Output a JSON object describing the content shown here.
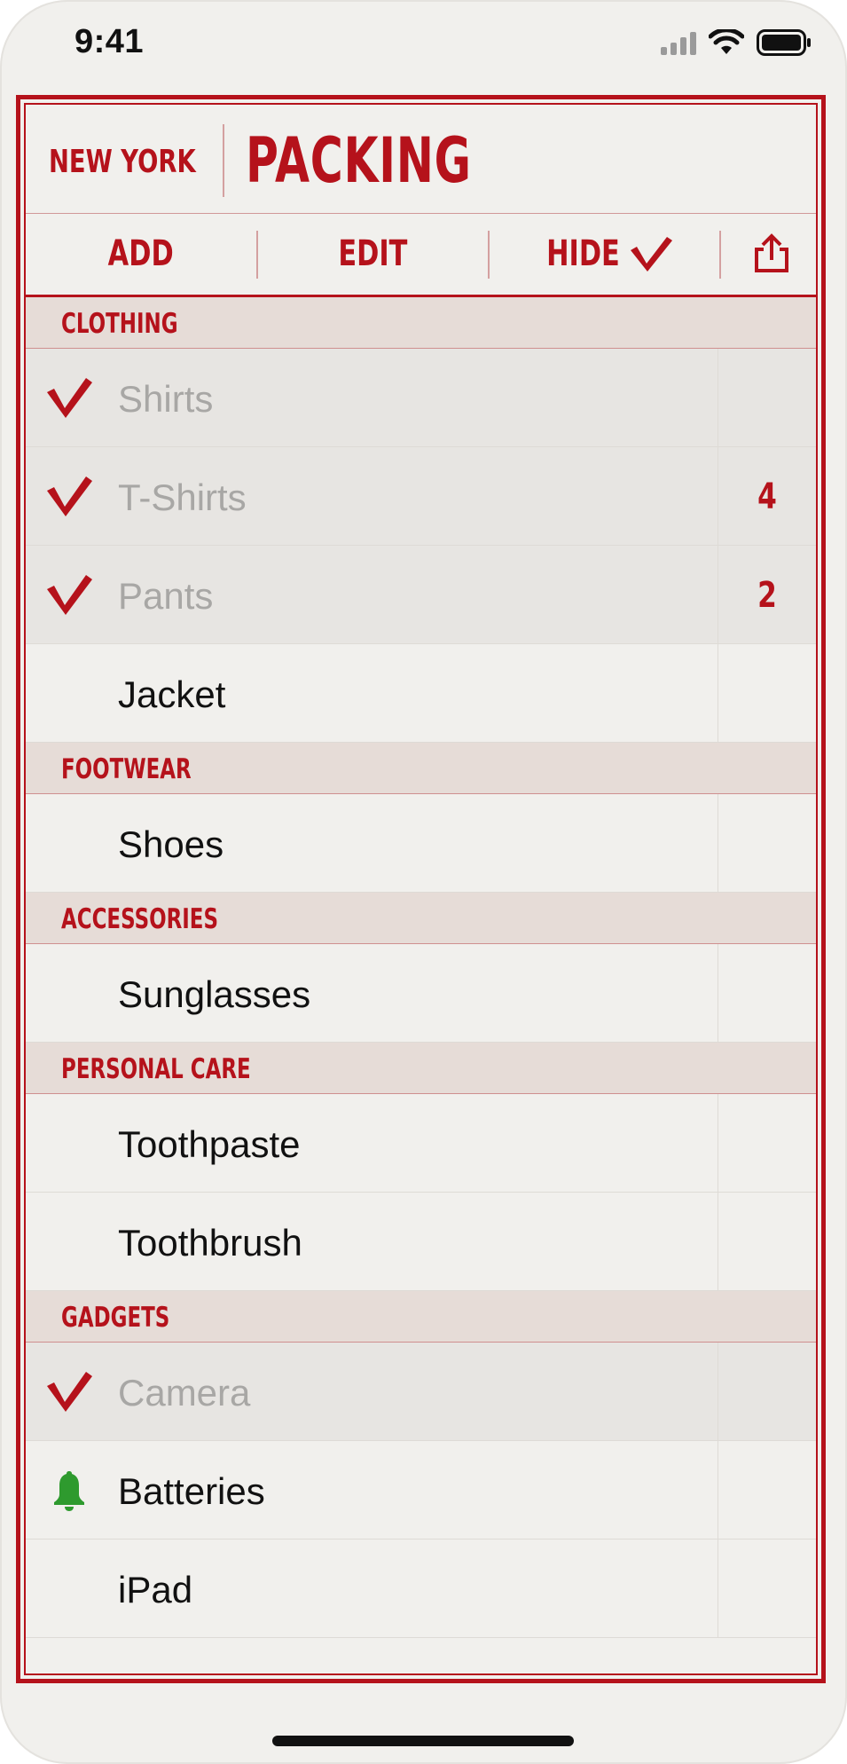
{
  "status": {
    "time": "9:41"
  },
  "header": {
    "city": "NEW YORK",
    "title": "PACKING"
  },
  "toolbar": {
    "add": "ADD",
    "edit": "EDIT",
    "hide": "HIDE",
    "share_icon": "share-icon"
  },
  "colors": {
    "accent": "#b5121b",
    "background": "#f1f0ed",
    "section_bg": "#e6dcd7",
    "checked_row_bg": "#e7e5e2",
    "bell": "#2e9a2e"
  },
  "sections": [
    {
      "label": "CLOTHING",
      "items": [
        {
          "name": "Shirts",
          "checked": true,
          "count": ""
        },
        {
          "name": "T-Shirts",
          "checked": true,
          "count": "4"
        },
        {
          "name": "Pants",
          "checked": true,
          "count": "2"
        },
        {
          "name": "Jacket",
          "checked": false,
          "count": ""
        }
      ]
    },
    {
      "label": "FOOTWEAR",
      "items": [
        {
          "name": "Shoes",
          "checked": false,
          "count": ""
        }
      ]
    },
    {
      "label": "ACCESSORIES",
      "items": [
        {
          "name": "Sunglasses",
          "checked": false,
          "count": ""
        }
      ]
    },
    {
      "label": "PERSONAL CARE",
      "items": [
        {
          "name": "Toothpaste",
          "checked": false,
          "count": ""
        },
        {
          "name": "Toothbrush",
          "checked": false,
          "count": ""
        }
      ]
    },
    {
      "label": "GADGETS",
      "items": [
        {
          "name": "Camera",
          "checked": true,
          "count": ""
        },
        {
          "name": "Batteries",
          "checked": false,
          "count": "",
          "reminder": true
        },
        {
          "name": "iPad",
          "checked": false,
          "count": ""
        }
      ]
    }
  ]
}
